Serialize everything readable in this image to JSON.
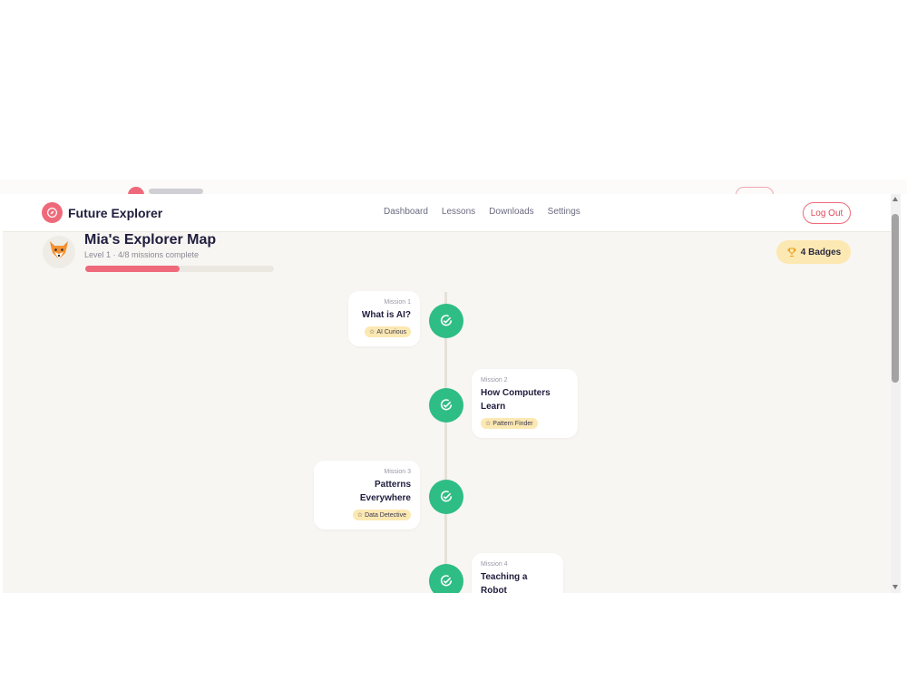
{
  "app": {
    "brand": "Future Explorer",
    "nav": [
      "Dashboard",
      "Lessons",
      "Downloads",
      "Settings"
    ],
    "logout_label": "Log Out"
  },
  "profile": {
    "name": "Mia's Explorer Map",
    "subtitle": "Level 1 · 4/8 missions complete",
    "progress_fraction": 0.5,
    "badges_label": "4 Badges"
  },
  "missions": [
    {
      "label": "Mission 1",
      "title": "What is AI?",
      "badge": "AI Curious",
      "status": "complete",
      "side": "left"
    },
    {
      "label": "Mission 2",
      "title": "How Computers Learn",
      "badge": "Pattern Finder",
      "status": "complete",
      "side": "right"
    },
    {
      "label": "Mission 3",
      "title": "Patterns Everywhere",
      "badge": "Data Detective",
      "status": "complete",
      "side": "left"
    },
    {
      "label": "Mission 4",
      "title": "Teaching a Robot",
      "badge": "",
      "status": "complete",
      "side": "right"
    }
  ],
  "colors": {
    "accent": "#ee6a7b",
    "complete": "#2ebd85",
    "badge_bg": "#fce8b2",
    "background": "#f8f6f2"
  },
  "icons": {
    "brand": "compass-icon",
    "avatar": "fox-icon",
    "badges": "trophy-icon",
    "node": "check-circle-icon",
    "mission_badge": "star-icon"
  }
}
